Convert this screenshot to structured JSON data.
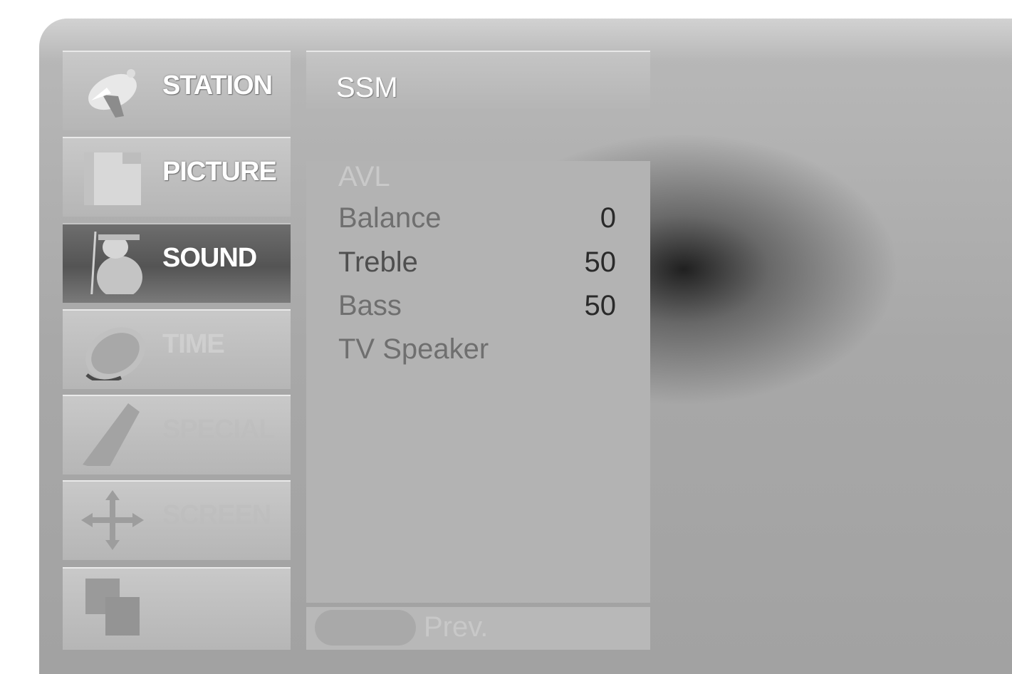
{
  "menu": {
    "items": [
      {
        "label": "STATION",
        "icon": "satellite-dish-icon"
      },
      {
        "label": "PICTURE",
        "icon": "picture-icon"
      },
      {
        "label": "SOUND",
        "icon": "speaker-icon",
        "active": true
      },
      {
        "label": "TIME",
        "icon": "clock-icon"
      },
      {
        "label": "SPECIAL",
        "icon": "special-icon"
      },
      {
        "label": "SCREEN",
        "icon": "screen-arrows-icon"
      },
      {
        "label": "",
        "icon": "layers-icon"
      }
    ]
  },
  "submenu": {
    "header": "SSM",
    "rows": [
      {
        "label": "AVL",
        "value": ""
      },
      {
        "label": "Balance",
        "value": "0"
      },
      {
        "label": "Treble",
        "value": "50"
      },
      {
        "label": "Bass",
        "value": "50"
      },
      {
        "label": "TV Speaker",
        "value": ""
      }
    ]
  },
  "footer": {
    "prev_label": "Prev."
  },
  "colors": {
    "active_item": "#5a5a5a",
    "panel": "#a9a9a9"
  }
}
